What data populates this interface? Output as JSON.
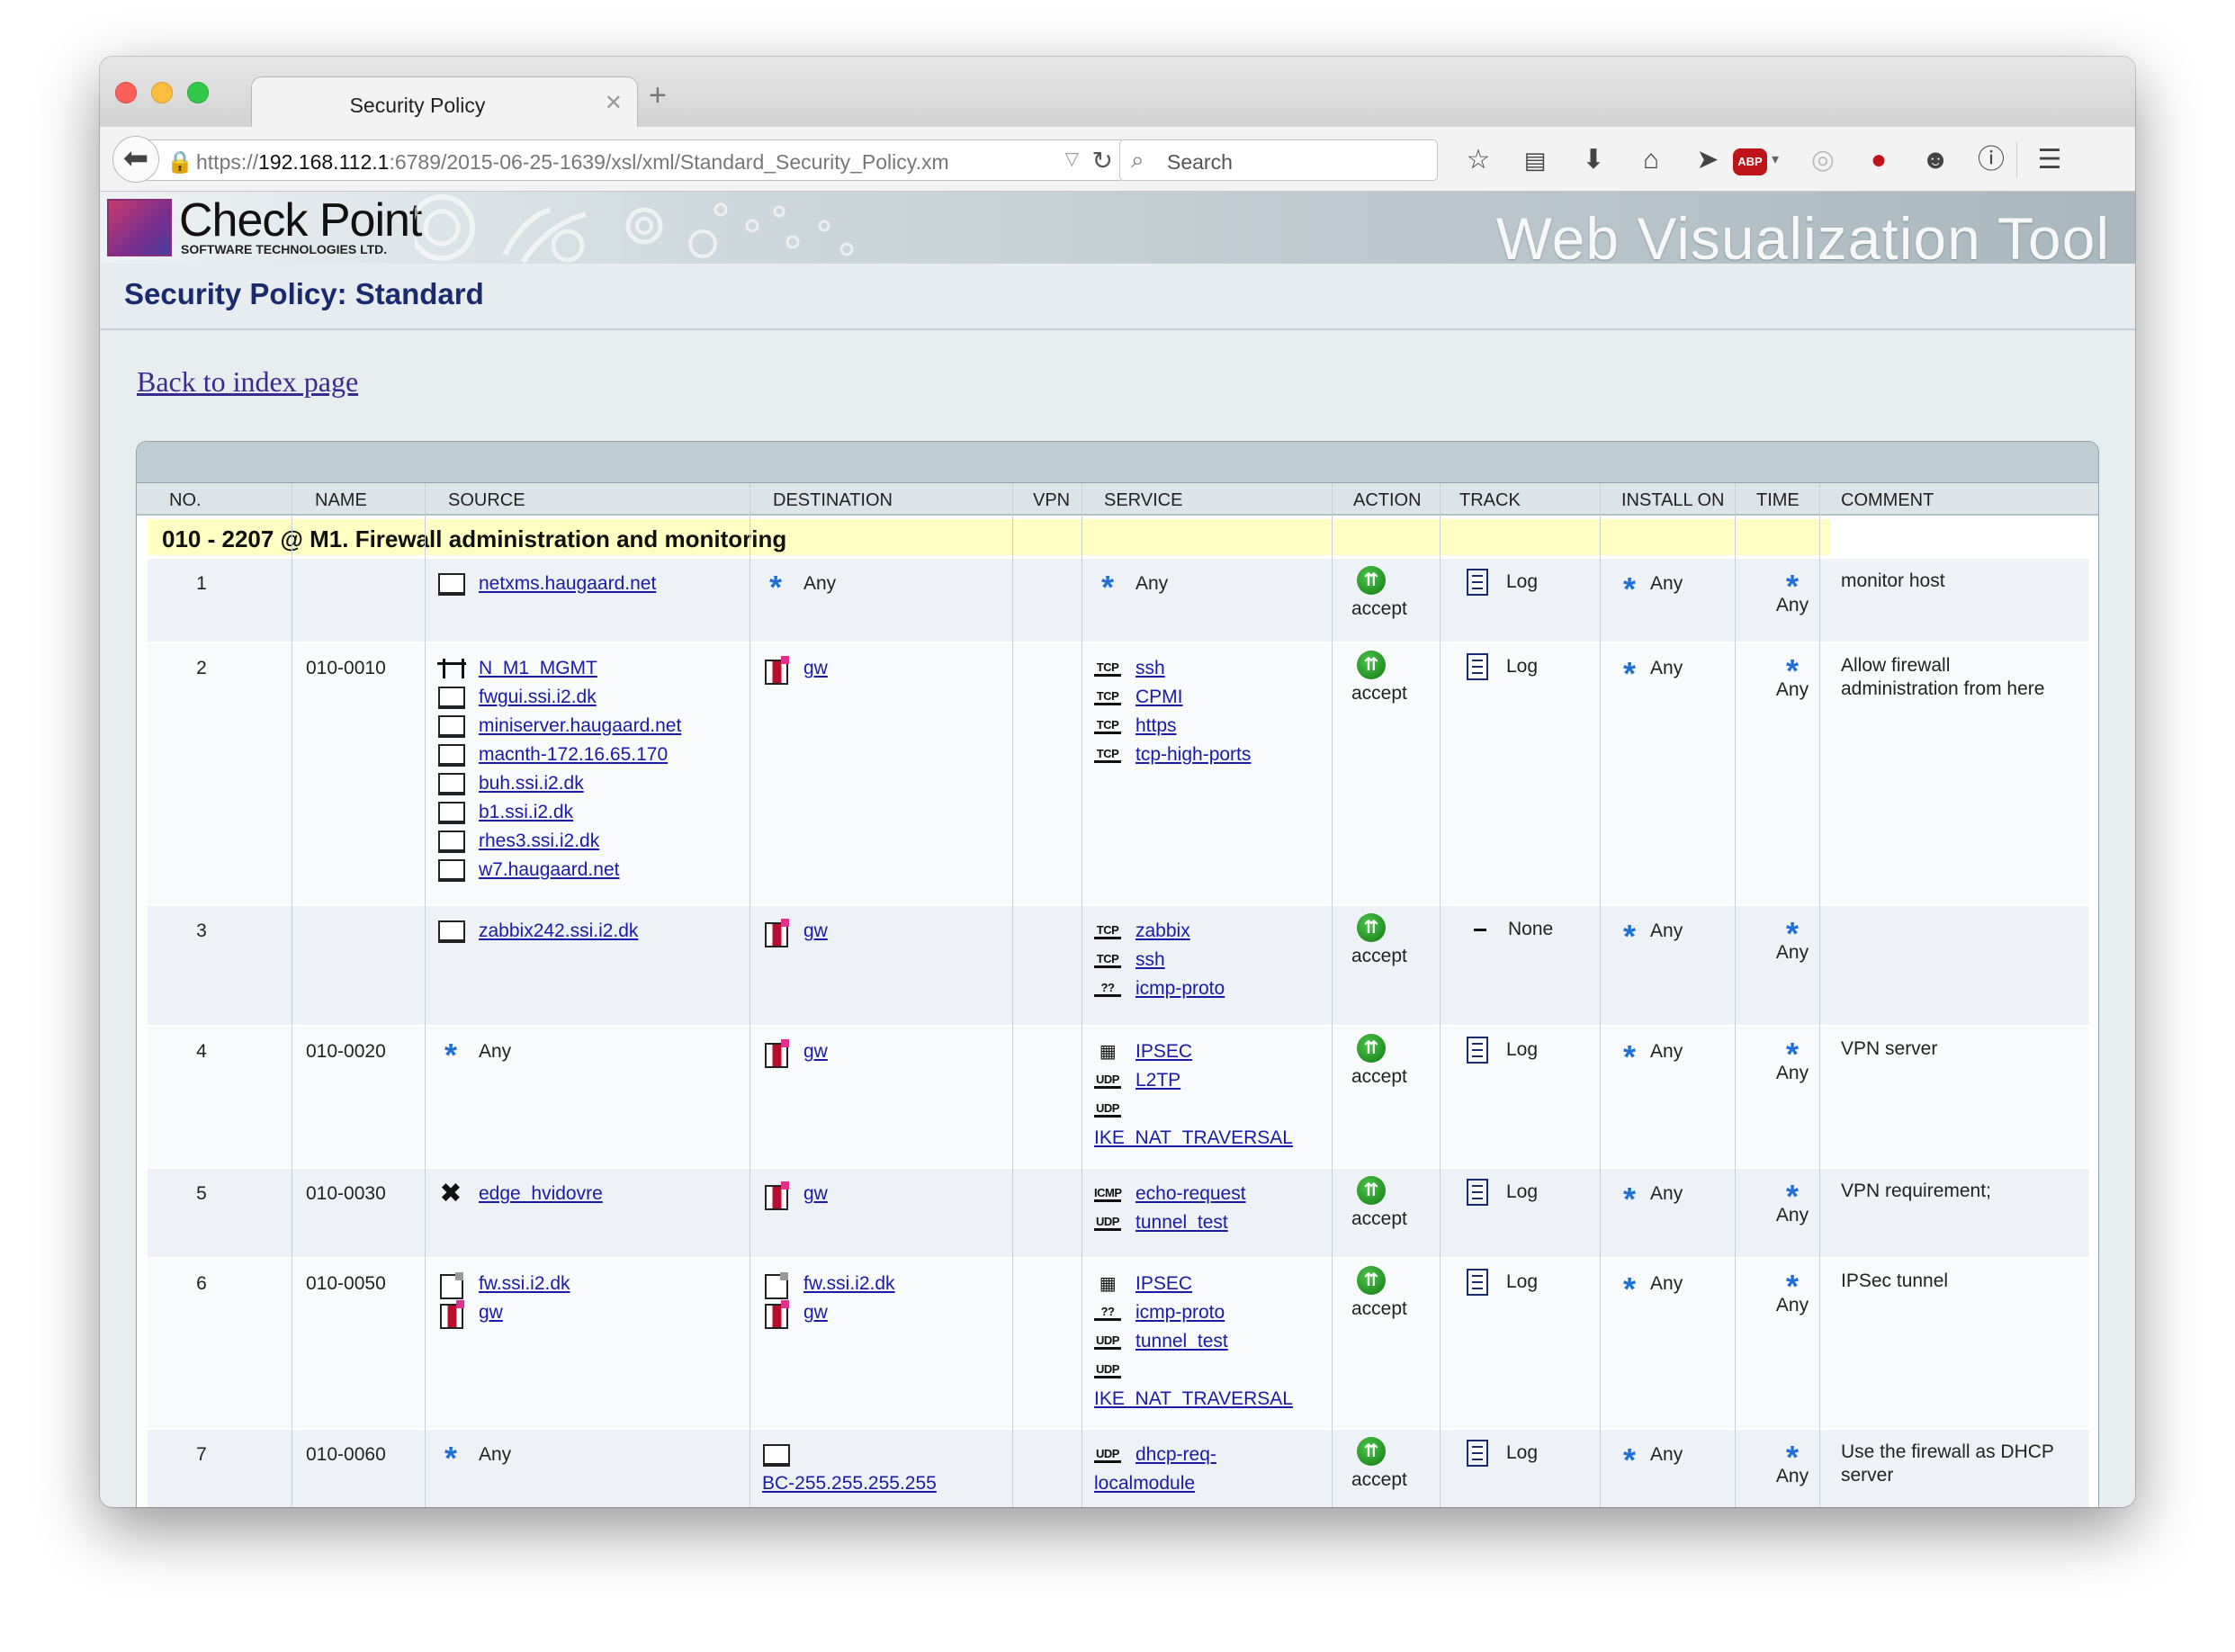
{
  "browser": {
    "tab_title": "Security Policy",
    "url_host_prefix": "https://",
    "url_host": "192.168.112.1",
    "url_rest": ":6789/2015-06-25-1639/xsl/xml/Standard_Security_Policy.xm",
    "search_placeholder": "Search",
    "abp_label": "ABP",
    "toolbar_icons": [
      "bookmark-star-icon",
      "reading-list-icon",
      "download-icon",
      "home-icon",
      "send-icon",
      "adblock-icon",
      "extension-spinner-icon",
      "extension-flame-icon",
      "chat-icon",
      "info-icon",
      "menu-icon"
    ]
  },
  "header": {
    "logo_name": "Check Point",
    "logo_sub": "SOFTWARE TECHNOLOGIES LTD.",
    "tool_title": "Web Visualization Tool",
    "page_title": "Security Policy: Standard",
    "back_link": "Back to index page"
  },
  "table": {
    "columns": [
      "NO.",
      "NAME",
      "SOURCE",
      "DESTINATION",
      "VPN",
      "SERVICE",
      "ACTION",
      "TRACK",
      "INSTALL ON",
      "TIME",
      "COMMENT"
    ],
    "section_title": "010 - 2207 @ M1. Firewall administration and monitoring",
    "rows": [
      {
        "no": "1",
        "name": "",
        "source": [
          {
            "icon": "host",
            "text": "netxms.haugaard.net",
            "link": true
          }
        ],
        "destination": [
          {
            "icon": "any",
            "text": "Any",
            "link": false
          }
        ],
        "service": [
          {
            "icon": "any",
            "text": "Any",
            "link": false
          }
        ],
        "action": "accept",
        "track": {
          "icon": "log",
          "text": "Log"
        },
        "install_on": "Any",
        "time": "Any",
        "comment": "monitor host"
      },
      {
        "no": "2",
        "name": "010-0010",
        "source": [
          {
            "icon": "network",
            "text": "N_M1_MGMT",
            "link": true
          },
          {
            "icon": "host",
            "text": "fwgui.ssi.i2.dk",
            "link": true
          },
          {
            "icon": "host",
            "text": "miniserver.haugaard.net",
            "link": true
          },
          {
            "icon": "host",
            "text": "macnth-172.16.65.170",
            "link": true
          },
          {
            "icon": "host",
            "text": "buh.ssi.i2.dk",
            "link": true
          },
          {
            "icon": "host",
            "text": "b1.ssi.i2.dk",
            "link": true
          },
          {
            "icon": "host",
            "text": "rhes3.ssi.i2.dk",
            "link": true
          },
          {
            "icon": "host",
            "text": "w7.haugaard.net",
            "link": true
          }
        ],
        "destination": [
          {
            "icon": "gateway",
            "text": "gw",
            "link": true
          }
        ],
        "service": [
          {
            "icon": "TCP",
            "text": "ssh",
            "link": true
          },
          {
            "icon": "TCP",
            "text": "CPMI",
            "link": true
          },
          {
            "icon": "TCP",
            "text": "https",
            "link": true
          },
          {
            "icon": "TCP",
            "text": "tcp-high-ports",
            "link": true
          }
        ],
        "action": "accept",
        "track": {
          "icon": "log",
          "text": "Log"
        },
        "install_on": "Any",
        "time": "Any",
        "comment": "Allow firewall administration from here"
      },
      {
        "no": "3",
        "name": "",
        "source": [
          {
            "icon": "host",
            "text": "zabbix242.ssi.i2.dk",
            "link": true
          }
        ],
        "destination": [
          {
            "icon": "gateway",
            "text": "gw",
            "link": true
          }
        ],
        "service": [
          {
            "icon": "TCP",
            "text": "zabbix",
            "link": true
          },
          {
            "icon": "TCP",
            "text": "ssh",
            "link": true
          },
          {
            "icon": "??",
            "text": "icmp-proto",
            "link": true
          }
        ],
        "action": "accept",
        "track": {
          "icon": "none",
          "text": "None"
        },
        "install_on": "Any",
        "time": "Any",
        "comment": ""
      },
      {
        "no": "4",
        "name": "010-0020",
        "source": [
          {
            "icon": "any",
            "text": "Any",
            "link": false
          }
        ],
        "destination": [
          {
            "icon": "gateway",
            "text": "gw",
            "link": true
          }
        ],
        "service": [
          {
            "icon": "GRP",
            "text": "IPSEC",
            "link": true
          },
          {
            "icon": "UDP",
            "text": "L2TP",
            "link": true
          },
          {
            "icon": "UDP",
            "text": "",
            "link": false
          },
          {
            "icon": "",
            "text": "IKE_NAT_TRAVERSAL",
            "link": true
          }
        ],
        "action": "accept",
        "track": {
          "icon": "log",
          "text": "Log"
        },
        "install_on": "Any",
        "time": "Any",
        "comment": "VPN server"
      },
      {
        "no": "5",
        "name": "010-0030",
        "source": [
          {
            "icon": "edge",
            "text": "edge_hvidovre",
            "link": true
          }
        ],
        "destination": [
          {
            "icon": "gateway",
            "text": "gw",
            "link": true
          }
        ],
        "service": [
          {
            "icon": "ICMP",
            "text": "echo-request",
            "link": true
          },
          {
            "icon": "UDP",
            "text": "tunnel_test",
            "link": true
          }
        ],
        "action": "accept",
        "track": {
          "icon": "log",
          "text": "Log"
        },
        "install_on": "Any",
        "time": "Any",
        "comment": "VPN requirement;"
      },
      {
        "no": "6",
        "name": "010-0050",
        "source": [
          {
            "icon": "firewall",
            "text": "fw.ssi.i2.dk",
            "link": true
          },
          {
            "icon": "gateway",
            "text": "gw",
            "link": true
          }
        ],
        "destination": [
          {
            "icon": "firewall",
            "text": "fw.ssi.i2.dk",
            "link": true
          },
          {
            "icon": "gateway",
            "text": "gw",
            "link": true
          }
        ],
        "service": [
          {
            "icon": "GRP",
            "text": "IPSEC",
            "link": true
          },
          {
            "icon": "??",
            "text": "icmp-proto",
            "link": true
          },
          {
            "icon": "UDP",
            "text": "tunnel_test",
            "link": true
          },
          {
            "icon": "UDP",
            "text": "",
            "link": false
          },
          {
            "icon": "",
            "text": "IKE_NAT_TRAVERSAL",
            "link": true
          }
        ],
        "action": "accept",
        "track": {
          "icon": "log",
          "text": "Log"
        },
        "install_on": "Any",
        "time": "Any",
        "comment": "IPSec tunnel"
      },
      {
        "no": "7",
        "name": "010-0060",
        "source": [
          {
            "icon": "any",
            "text": "Any",
            "link": false
          }
        ],
        "destination": [
          {
            "icon": "host",
            "text": "",
            "link": false
          },
          {
            "icon": "",
            "text": "BC-255.255.255.255",
            "link": true
          }
        ],
        "service": [
          {
            "icon": "UDP",
            "text": "dhcp-req-",
            "link": true
          },
          {
            "icon": "",
            "text": "localmodule",
            "link": true
          }
        ],
        "action": "accept",
        "track": {
          "icon": "log",
          "text": "Log"
        },
        "install_on": "Any",
        "time": "Any",
        "comment": "Use the firewall as DHCP server"
      }
    ]
  }
}
